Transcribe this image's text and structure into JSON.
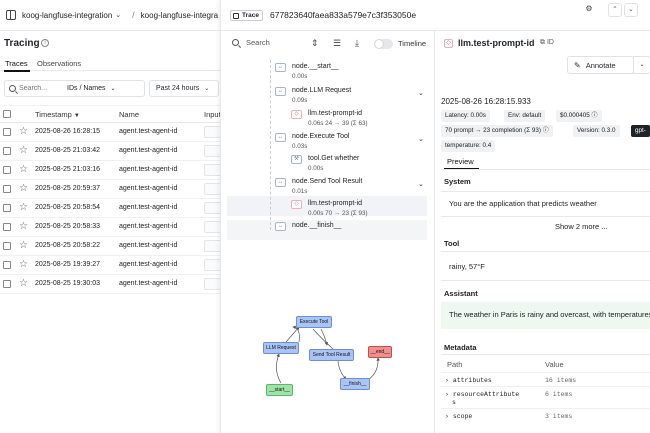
{
  "breadcrumb": {
    "project": "koog-langfuse-integration",
    "project_dup": "koog-langfuse-integra"
  },
  "left": {
    "title": "Tracing",
    "tabs": [
      "Traces",
      "Observations"
    ],
    "search_placeholder": "Search...",
    "search_scope": "IDs / Names",
    "time_range": "Past 24 hours",
    "columns": [
      "Timestamp",
      "Name",
      "Input"
    ],
    "rows": [
      {
        "timestamp": "2025-08-26 16:28:15",
        "name": "agent.test-agent-id"
      },
      {
        "timestamp": "2025-08-25 21:03:42",
        "name": "agent.test-agent-id"
      },
      {
        "timestamp": "2025-08-25 21:03:16",
        "name": "agent.test-agent-id"
      },
      {
        "timestamp": "2025-08-25 20:59:37",
        "name": "agent.test-agent-id"
      },
      {
        "timestamp": "2025-08-25 20:58:54",
        "name": "agent.test-agent-id"
      },
      {
        "timestamp": "2025-08-25 20:58:33",
        "name": "agent.test-agent-id"
      },
      {
        "timestamp": "2025-08-25 20:58:22",
        "name": "agent.test-agent-id"
      },
      {
        "timestamp": "2025-08-25 19:39:27",
        "name": "agent.test-agent-id"
      },
      {
        "timestamp": "2025-08-25 19:30:03",
        "name": "agent.test-agent-id"
      }
    ]
  },
  "trace": {
    "badge": "Trace",
    "id": "677823640faea833a579e7c3f353050e",
    "search_label": "Search",
    "timeline_label": "Timeline",
    "nodes": [
      {
        "name": "node.__start__",
        "meta": "0.00s"
      },
      {
        "name": "node.LLM Request",
        "meta": "0.09s"
      },
      {
        "name": "llm.test-prompt-id",
        "meta": "0.06s   24 → 39 (Σ 63)"
      },
      {
        "name": "node.Execute Tool",
        "meta": "0.03s"
      },
      {
        "name": "tool.Get whether",
        "meta": "0.00s"
      },
      {
        "name": "node.Send Tool Result",
        "meta": "0.01s"
      },
      {
        "name": "llm.test-prompt-id",
        "meta": "0.00s   70 → 23 (Σ 93)"
      },
      {
        "name": "node.__finish__",
        "meta": "0.00s"
      }
    ],
    "graph": {
      "execute_tool": "Execute Tool",
      "llm_request": "LLM Request",
      "send_tool_result": "Send Tool Result",
      "end": "__end__",
      "start": "__start__",
      "finish": "__finish__"
    }
  },
  "detail": {
    "title": "llm.test-prompt-id",
    "annotate": "Annotate",
    "date": "2025-08-26 16:28:15.933",
    "badges": {
      "latency": "Latency: 0.00s",
      "env": "Env: default",
      "cost": "$0.000405",
      "tokens": "70 prompt → 23 completion (Σ 93)",
      "version": "Version: 0.3.0",
      "model": "gpt-",
      "temperature": "temperature: 0.4"
    },
    "preview_tab": "Preview",
    "system_title": "System",
    "system_text": "You are the application that predicts weather",
    "show_more": "Show 2 more ...",
    "tool_title": "Tool",
    "tool_text": "rainy, 57°F",
    "assistant_title": "Assistant",
    "assistant_text": "The weather in Paris is rainy and overcast, with temperatures",
    "metadata_title": "Metadata",
    "metadata_cols": [
      "Path",
      "Value"
    ],
    "metadata_rows": [
      {
        "path": "attributes",
        "value": "16 items"
      },
      {
        "path": "resourceAttribute",
        "path2": "s",
        "value": "6 items"
      },
      {
        "path": "scope",
        "value": "3 items"
      }
    ]
  }
}
